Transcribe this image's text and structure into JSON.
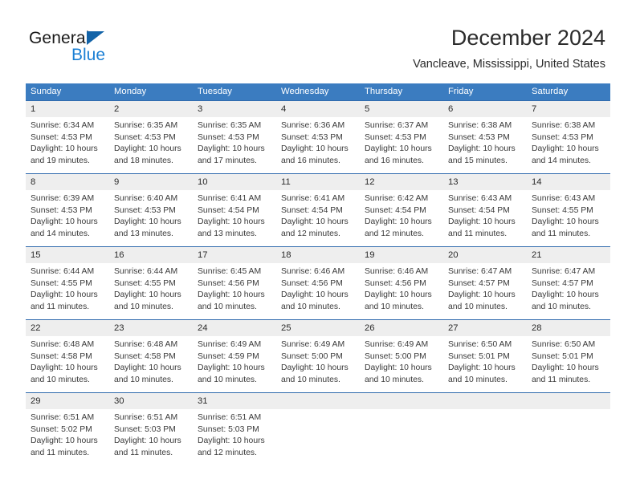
{
  "logo": {
    "word_top": "General",
    "word_bottom": "Blue",
    "triangle_color": "#1263a8",
    "blue_color": "#1a7fd4"
  },
  "header": {
    "title": "December 2024",
    "location": "Vancleave, Mississippi, United States"
  },
  "theme": {
    "header_band": "#3b7cc0",
    "week_divider": "#2f6aad",
    "day_band": "#eeeeee",
    "text": "#3a3a3a"
  },
  "weekday_headers": [
    "Sunday",
    "Monday",
    "Tuesday",
    "Wednesday",
    "Thursday",
    "Friday",
    "Saturday"
  ],
  "weeks": [
    [
      {
        "day": "1",
        "sunrise": "Sunrise: 6:34 AM",
        "sunset": "Sunset: 4:53 PM",
        "daylight1": "Daylight: 10 hours",
        "daylight2": "and 19 minutes."
      },
      {
        "day": "2",
        "sunrise": "Sunrise: 6:35 AM",
        "sunset": "Sunset: 4:53 PM",
        "daylight1": "Daylight: 10 hours",
        "daylight2": "and 18 minutes."
      },
      {
        "day": "3",
        "sunrise": "Sunrise: 6:35 AM",
        "sunset": "Sunset: 4:53 PM",
        "daylight1": "Daylight: 10 hours",
        "daylight2": "and 17 minutes."
      },
      {
        "day": "4",
        "sunrise": "Sunrise: 6:36 AM",
        "sunset": "Sunset: 4:53 PM",
        "daylight1": "Daylight: 10 hours",
        "daylight2": "and 16 minutes."
      },
      {
        "day": "5",
        "sunrise": "Sunrise: 6:37 AM",
        "sunset": "Sunset: 4:53 PM",
        "daylight1": "Daylight: 10 hours",
        "daylight2": "and 16 minutes."
      },
      {
        "day": "6",
        "sunrise": "Sunrise: 6:38 AM",
        "sunset": "Sunset: 4:53 PM",
        "daylight1": "Daylight: 10 hours",
        "daylight2": "and 15 minutes."
      },
      {
        "day": "7",
        "sunrise": "Sunrise: 6:38 AM",
        "sunset": "Sunset: 4:53 PM",
        "daylight1": "Daylight: 10 hours",
        "daylight2": "and 14 minutes."
      }
    ],
    [
      {
        "day": "8",
        "sunrise": "Sunrise: 6:39 AM",
        "sunset": "Sunset: 4:53 PM",
        "daylight1": "Daylight: 10 hours",
        "daylight2": "and 14 minutes."
      },
      {
        "day": "9",
        "sunrise": "Sunrise: 6:40 AM",
        "sunset": "Sunset: 4:53 PM",
        "daylight1": "Daylight: 10 hours",
        "daylight2": "and 13 minutes."
      },
      {
        "day": "10",
        "sunrise": "Sunrise: 6:41 AM",
        "sunset": "Sunset: 4:54 PM",
        "daylight1": "Daylight: 10 hours",
        "daylight2": "and 13 minutes."
      },
      {
        "day": "11",
        "sunrise": "Sunrise: 6:41 AM",
        "sunset": "Sunset: 4:54 PM",
        "daylight1": "Daylight: 10 hours",
        "daylight2": "and 12 minutes."
      },
      {
        "day": "12",
        "sunrise": "Sunrise: 6:42 AM",
        "sunset": "Sunset: 4:54 PM",
        "daylight1": "Daylight: 10 hours",
        "daylight2": "and 12 minutes."
      },
      {
        "day": "13",
        "sunrise": "Sunrise: 6:43 AM",
        "sunset": "Sunset: 4:54 PM",
        "daylight1": "Daylight: 10 hours",
        "daylight2": "and 11 minutes."
      },
      {
        "day": "14",
        "sunrise": "Sunrise: 6:43 AM",
        "sunset": "Sunset: 4:55 PM",
        "daylight1": "Daylight: 10 hours",
        "daylight2": "and 11 minutes."
      }
    ],
    [
      {
        "day": "15",
        "sunrise": "Sunrise: 6:44 AM",
        "sunset": "Sunset: 4:55 PM",
        "daylight1": "Daylight: 10 hours",
        "daylight2": "and 11 minutes."
      },
      {
        "day": "16",
        "sunrise": "Sunrise: 6:44 AM",
        "sunset": "Sunset: 4:55 PM",
        "daylight1": "Daylight: 10 hours",
        "daylight2": "and 10 minutes."
      },
      {
        "day": "17",
        "sunrise": "Sunrise: 6:45 AM",
        "sunset": "Sunset: 4:56 PM",
        "daylight1": "Daylight: 10 hours",
        "daylight2": "and 10 minutes."
      },
      {
        "day": "18",
        "sunrise": "Sunrise: 6:46 AM",
        "sunset": "Sunset: 4:56 PM",
        "daylight1": "Daylight: 10 hours",
        "daylight2": "and 10 minutes."
      },
      {
        "day": "19",
        "sunrise": "Sunrise: 6:46 AM",
        "sunset": "Sunset: 4:56 PM",
        "daylight1": "Daylight: 10 hours",
        "daylight2": "and 10 minutes."
      },
      {
        "day": "20",
        "sunrise": "Sunrise: 6:47 AM",
        "sunset": "Sunset: 4:57 PM",
        "daylight1": "Daylight: 10 hours",
        "daylight2": "and 10 minutes."
      },
      {
        "day": "21",
        "sunrise": "Sunrise: 6:47 AM",
        "sunset": "Sunset: 4:57 PM",
        "daylight1": "Daylight: 10 hours",
        "daylight2": "and 10 minutes."
      }
    ],
    [
      {
        "day": "22",
        "sunrise": "Sunrise: 6:48 AM",
        "sunset": "Sunset: 4:58 PM",
        "daylight1": "Daylight: 10 hours",
        "daylight2": "and 10 minutes."
      },
      {
        "day": "23",
        "sunrise": "Sunrise: 6:48 AM",
        "sunset": "Sunset: 4:58 PM",
        "daylight1": "Daylight: 10 hours",
        "daylight2": "and 10 minutes."
      },
      {
        "day": "24",
        "sunrise": "Sunrise: 6:49 AM",
        "sunset": "Sunset: 4:59 PM",
        "daylight1": "Daylight: 10 hours",
        "daylight2": "and 10 minutes."
      },
      {
        "day": "25",
        "sunrise": "Sunrise: 6:49 AM",
        "sunset": "Sunset: 5:00 PM",
        "daylight1": "Daylight: 10 hours",
        "daylight2": "and 10 minutes."
      },
      {
        "day": "26",
        "sunrise": "Sunrise: 6:49 AM",
        "sunset": "Sunset: 5:00 PM",
        "daylight1": "Daylight: 10 hours",
        "daylight2": "and 10 minutes."
      },
      {
        "day": "27",
        "sunrise": "Sunrise: 6:50 AM",
        "sunset": "Sunset: 5:01 PM",
        "daylight1": "Daylight: 10 hours",
        "daylight2": "and 10 minutes."
      },
      {
        "day": "28",
        "sunrise": "Sunrise: 6:50 AM",
        "sunset": "Sunset: 5:01 PM",
        "daylight1": "Daylight: 10 hours",
        "daylight2": "and 11 minutes."
      }
    ],
    [
      {
        "day": "29",
        "sunrise": "Sunrise: 6:51 AM",
        "sunset": "Sunset: 5:02 PM",
        "daylight1": "Daylight: 10 hours",
        "daylight2": "and 11 minutes."
      },
      {
        "day": "30",
        "sunrise": "Sunrise: 6:51 AM",
        "sunset": "Sunset: 5:03 PM",
        "daylight1": "Daylight: 10 hours",
        "daylight2": "and 11 minutes."
      },
      {
        "day": "31",
        "sunrise": "Sunrise: 6:51 AM",
        "sunset": "Sunset: 5:03 PM",
        "daylight1": "Daylight: 10 hours",
        "daylight2": "and 12 minutes."
      },
      {
        "day": "",
        "sunrise": "",
        "sunset": "",
        "daylight1": "",
        "daylight2": ""
      },
      {
        "day": "",
        "sunrise": "",
        "sunset": "",
        "daylight1": "",
        "daylight2": ""
      },
      {
        "day": "",
        "sunrise": "",
        "sunset": "",
        "daylight1": "",
        "daylight2": ""
      },
      {
        "day": "",
        "sunrise": "",
        "sunset": "",
        "daylight1": "",
        "daylight2": ""
      }
    ]
  ]
}
